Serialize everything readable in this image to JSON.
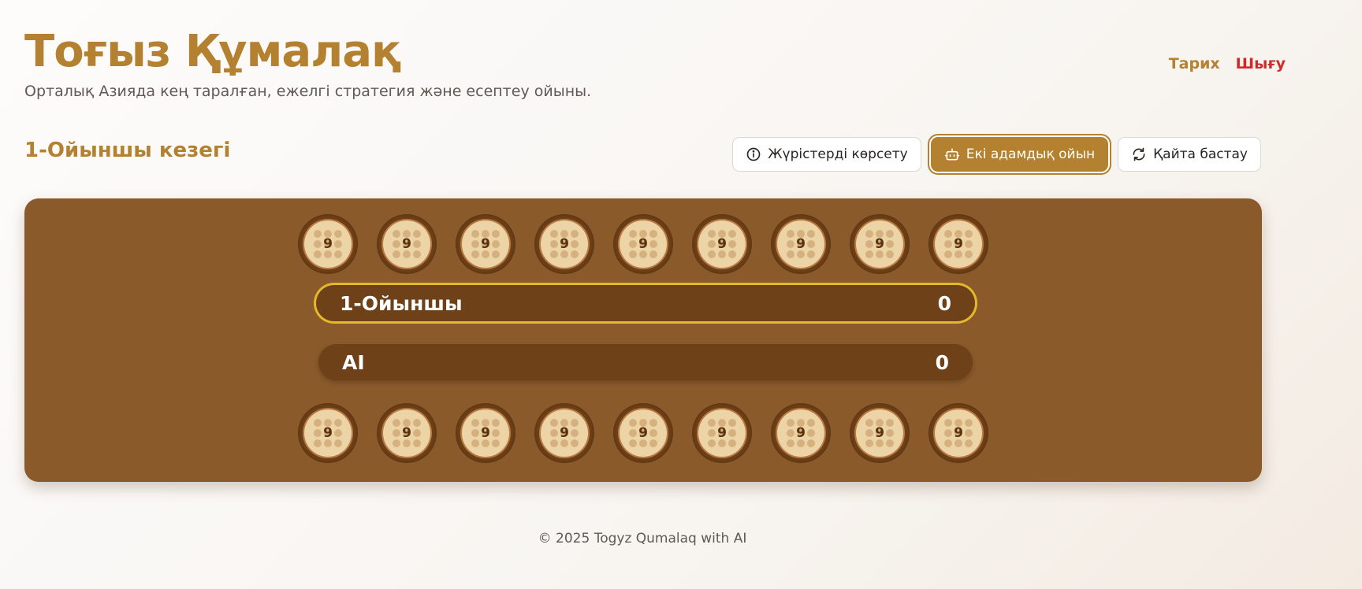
{
  "header": {
    "title": "Тоғыз Құмалақ",
    "subtitle": "Орталық Азияда кең таралған, ежелгі стратегия және есептеу ойыны.",
    "nav": {
      "history": "Тарих",
      "logout": "Шығу"
    }
  },
  "game": {
    "turn_label": "1-Ойыншы кезегі",
    "controls": {
      "show_moves": "Жүрістерді көрсету",
      "two_player": "Екі адамдық ойын",
      "restart": "Қайта бастау"
    },
    "board": {
      "top_pits": [
        9,
        9,
        9,
        9,
        9,
        9,
        9,
        9,
        9
      ],
      "bottom_pits": [
        9,
        9,
        9,
        9,
        9,
        9,
        9,
        9,
        9
      ],
      "player1": {
        "name": "1-Ойыншы",
        "score": "0"
      },
      "ai": {
        "name": "AI",
        "score": "0"
      }
    }
  },
  "footer": {
    "text": "© 2025 Togyz Qumalaq with AI"
  },
  "colors": {
    "accent": "#b3812f",
    "board": "#8a5a2b",
    "pit_outer": "#724319",
    "pit_inner": "#ecd4a7",
    "score_bar": "#6e4118",
    "active_outline": "#e4b82a",
    "logout": "#d02a2a"
  }
}
